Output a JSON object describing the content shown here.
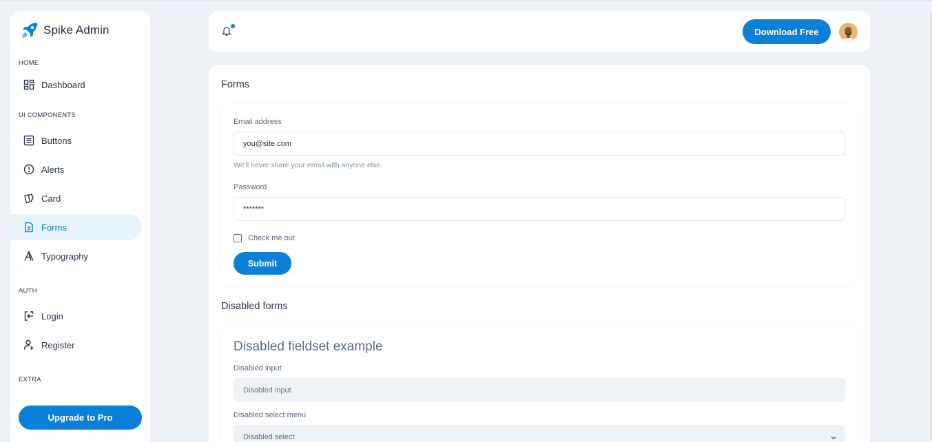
{
  "brand": {
    "name": "Spike Admin",
    "accent": "#0b80d8"
  },
  "sidebar": {
    "captions": {
      "home": "HOME",
      "ui_components": "UI COMPONENTS",
      "auth": "AUTH",
      "extra": "EXTRA"
    },
    "items": [
      {
        "label": "Dashboard",
        "icon": "dashboard-icon"
      },
      {
        "label": "Buttons",
        "icon": "list-icon"
      },
      {
        "label": "Alerts",
        "icon": "alert-circle-icon"
      },
      {
        "label": "Card",
        "icon": "cards-icon"
      },
      {
        "label": "Forms",
        "icon": "file-text-icon",
        "active": true
      },
      {
        "label": "Typography",
        "icon": "typography-icon"
      },
      {
        "label": "Login",
        "icon": "login-icon"
      },
      {
        "label": "Register",
        "icon": "user-plus-icon"
      }
    ],
    "upgrade_label": "Upgrade to Pro"
  },
  "topbar": {
    "notification_icon": "bell-icon",
    "download_label": "Download Free"
  },
  "forms": {
    "title": "Forms",
    "email_label": "Email address",
    "email_value": "you@site.com",
    "email_help": "We'll never share your email with anyone else.",
    "password_label": "Password",
    "password_value": "*******",
    "check_label": "Check me out",
    "submit_label": "Submit"
  },
  "disabled_forms": {
    "title": "Disabled forms",
    "legend": "Disabled fieldset example",
    "input_label": "Disabled input",
    "input_placeholder": "Disabled input",
    "select_label": "Disabled select menu",
    "select_value": "Disabled select"
  }
}
